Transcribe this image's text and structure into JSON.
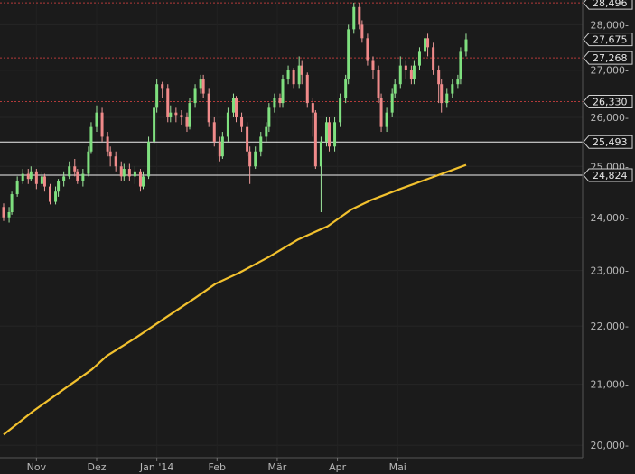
{
  "chart_data": {
    "type": "candlestick",
    "y_scale": "log",
    "ylim": [
      19800,
      28560
    ],
    "y_ticks": [
      {
        "value": 20000,
        "label": "20,000-"
      },
      {
        "value": 21000,
        "label": "21,000-"
      },
      {
        "value": 22000,
        "label": "22,000-"
      },
      {
        "value": 23000,
        "label": "23,000-"
      },
      {
        "value": 24000,
        "label": "24,000-"
      },
      {
        "value": 25000,
        "label": "25,000-"
      },
      {
        "value": 26000,
        "label": "26,000-"
      },
      {
        "value": 27000,
        "label": "27,000-"
      },
      {
        "value": 28000,
        "label": "28,000-"
      }
    ],
    "x_ticks": [
      "Nov",
      "Dez",
      "Jan '14",
      "Feb",
      "Mär",
      "Apr",
      "Mai"
    ],
    "x_tick_positions": [
      12,
      34,
      56,
      78,
      100,
      122,
      144
    ],
    "num_bars": 170,
    "horizontal_levels": [
      {
        "value": 28496,
        "label": "28,496",
        "style": "dotted-red"
      },
      {
        "value": 27675,
        "label": "27,675",
        "style": "none"
      },
      {
        "value": 27268,
        "label": "27,268",
        "style": "dotted-red"
      },
      {
        "value": 26330,
        "label": "26,330",
        "style": "dotted-red"
      },
      {
        "value": 25493,
        "label": "25,493",
        "style": "solid-white"
      },
      {
        "value": 24824,
        "label": "24,824",
        "style": "solid-white"
      }
    ],
    "moving_average": [
      [
        0,
        20170
      ],
      [
        10,
        20550
      ],
      [
        20,
        20900
      ],
      [
        30,
        21250
      ],
      [
        35,
        21480
      ],
      [
        45,
        21800
      ],
      [
        55,
        22150
      ],
      [
        65,
        22500
      ],
      [
        72,
        22760
      ],
      [
        80,
        22960
      ],
      [
        90,
        23250
      ],
      [
        100,
        23580
      ],
      [
        110,
        23830
      ],
      [
        118,
        24150
      ],
      [
        125,
        24340
      ],
      [
        135,
        24560
      ],
      [
        145,
        24770
      ],
      [
        152,
        24920
      ],
      [
        157,
        25030
      ]
    ],
    "candles": [
      [
        24200,
        24000,
        24270,
        23930
      ],
      [
        24000,
        24100,
        24200,
        23900
      ],
      [
        24100,
        24450,
        24500,
        24050
      ],
      [
        24450,
        24700,
        24800,
        24400
      ],
      [
        24700,
        24850,
        24950,
        24650
      ],
      [
        24850,
        24750,
        24950,
        24650
      ],
      [
        24750,
        24900,
        25000,
        24700
      ],
      [
        24900,
        24650,
        24950,
        24550
      ],
      [
        24650,
        24800,
        24900,
        24600
      ],
      [
        24800,
        24600,
        24850,
        24500
      ],
      [
        24600,
        24300,
        24650,
        24250
      ],
      [
        24300,
        24500,
        24600,
        24250
      ],
      [
        24500,
        24700,
        24750,
        24400
      ],
      [
        24700,
        24800,
        24900,
        24600
      ],
      [
        24800,
        25000,
        25100,
        24750
      ],
      [
        25000,
        24900,
        25150,
        24800
      ],
      [
        24900,
        24700,
        24950,
        24650
      ],
      [
        24700,
        24850,
        24950,
        24600
      ],
      [
        24850,
        25300,
        25400,
        24800
      ],
      [
        25300,
        25800,
        25900,
        25250
      ],
      [
        25800,
        26100,
        26250,
        25700
      ],
      [
        26100,
        25600,
        26200,
        25500
      ],
      [
        25600,
        25300,
        25700,
        25200
      ],
      [
        25300,
        25200,
        25400,
        25000
      ],
      [
        25200,
        25000,
        25300,
        24900
      ],
      [
        25000,
        24800,
        25100,
        24700
      ],
      [
        24800,
        24950,
        25050,
        24700
      ],
      [
        24950,
        24800,
        25050,
        24700
      ],
      [
        24800,
        24900,
        25000,
        24650
      ],
      [
        24900,
        24600,
        24950,
        24500
      ],
      [
        24600,
        24800,
        24900,
        24550
      ],
      [
        24800,
        25500,
        25600,
        24750
      ],
      [
        25500,
        26200,
        26300,
        25450
      ],
      [
        26200,
        26700,
        26800,
        26100
      ],
      [
        26700,
        26600,
        26750,
        26400
      ],
      [
        26600,
        26000,
        26700,
        25900
      ],
      [
        26000,
        26100,
        26250,
        25900
      ],
      [
        26100,
        26050,
        26200,
        25900
      ],
      [
        26050,
        26000,
        26150,
        25850
      ],
      [
        26000,
        25800,
        26100,
        25700
      ],
      [
        25800,
        26300,
        26400,
        25750
      ],
      [
        26300,
        26600,
        26700,
        26200
      ],
      [
        26600,
        26800,
        26900,
        26500
      ],
      [
        26800,
        26500,
        26900,
        26400
      ],
      [
        26500,
        25900,
        26600,
        25800
      ],
      [
        25900,
        25500,
        26000,
        25400
      ],
      [
        25500,
        25200,
        25600,
        25100
      ],
      [
        25200,
        25600,
        25700,
        25150
      ],
      [
        25600,
        26100,
        26200,
        25500
      ],
      [
        26100,
        26400,
        26500,
        26000
      ],
      [
        26400,
        26000,
        26450,
        25900
      ],
      [
        26000,
        25800,
        26100,
        25700
      ],
      [
        25800,
        25300,
        25900,
        25200
      ],
      [
        25300,
        25000,
        25400,
        24650
      ],
      [
        25000,
        25300,
        25400,
        24950
      ],
      [
        25300,
        25600,
        25700,
        25200
      ],
      [
        25600,
        25800,
        25900,
        25500
      ],
      [
        25800,
        26200,
        26300,
        25700
      ],
      [
        26200,
        26400,
        26500,
        26100
      ],
      [
        26400,
        26300,
        26500,
        26200
      ],
      [
        26300,
        26800,
        26900,
        26200
      ],
      [
        26800,
        27000,
        27100,
        26700
      ],
      [
        27000,
        26700,
        27050,
        26600
      ],
      [
        26700,
        27100,
        27300,
        26600
      ],
      [
        27100,
        26900,
        27200,
        26700
      ],
      [
        26900,
        26300,
        26950,
        26200
      ],
      [
        26300,
        26100,
        26400,
        25600
      ],
      [
        26100,
        25000,
        26150,
        24950
      ],
      [
        25000,
        25500,
        25600,
        24100
      ],
      [
        25500,
        25900,
        26000,
        25400
      ],
      [
        25900,
        25400,
        26000,
        25300
      ],
      [
        25400,
        25900,
        26000,
        25300
      ],
      [
        25900,
        26400,
        26500,
        25800
      ],
      [
        26400,
        26800,
        26900,
        26300
      ],
      [
        26800,
        27900,
        28000,
        26700
      ],
      [
        27900,
        28400,
        28500,
        27800
      ],
      [
        28400,
        28000,
        28496,
        27900
      ],
      [
        28000,
        27700,
        28100,
        27600
      ],
      [
        27700,
        27200,
        27800,
        27100
      ],
      [
        27200,
        27000,
        27300,
        26800
      ],
      [
        27000,
        26400,
        27100,
        26300
      ],
      [
        26400,
        25800,
        26500,
        25700
      ],
      [
        25800,
        26100,
        26200,
        25700
      ],
      [
        26100,
        26500,
        26600,
        26000
      ],
      [
        26500,
        26700,
        26800,
        26400
      ],
      [
        26700,
        27100,
        27300,
        26600
      ],
      [
        27100,
        27000,
        27200,
        26800
      ],
      [
        27000,
        26800,
        27100,
        26700
      ],
      [
        26800,
        27100,
        27200,
        26700
      ],
      [
        27100,
        27400,
        27500,
        27000
      ],
      [
        27400,
        27700,
        27800,
        27300
      ],
      [
        27700,
        27500,
        27800,
        27300
      ],
      [
        27500,
        27000,
        27600,
        26900
      ],
      [
        27000,
        26700,
        27100,
        26300
      ],
      [
        26700,
        26300,
        26800,
        26100
      ],
      [
        26300,
        26500,
        26600,
        26200
      ],
      [
        26500,
        26700,
        26800,
        26400
      ],
      [
        26700,
        26800,
        26900,
        26600
      ],
      [
        26800,
        27400,
        27500,
        26700
      ],
      [
        27400,
        27675,
        27800,
        27300
      ]
    ]
  }
}
